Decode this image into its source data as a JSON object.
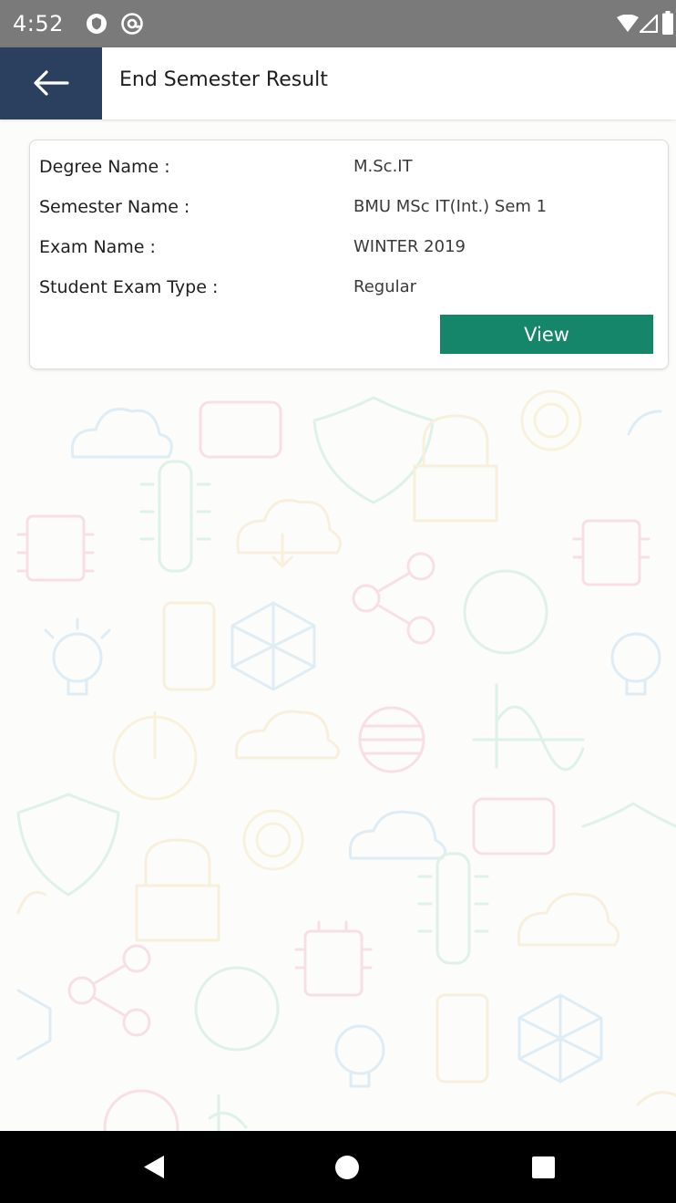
{
  "status_bar": {
    "time": "4:52",
    "left_icons": [
      "shield-icon",
      "at-sign-icon"
    ],
    "right_icons": [
      "wifi-icon",
      "signal-icon",
      "battery-icon"
    ],
    "background": "#7a7a7a"
  },
  "app_bar": {
    "title": "End Semester Result",
    "back_icon": "arrow-left-icon",
    "back_background": "#2b3f5f"
  },
  "result_card": {
    "rows": [
      {
        "label": "Degree Name :",
        "value": "M.Sc.IT"
      },
      {
        "label": "Semester Name :",
        "value": "BMU MSc IT(Int.) Sem 1"
      },
      {
        "label": "Exam Name :",
        "value": "WINTER 2019"
      },
      {
        "label": "Student Exam Type :",
        "value": "Regular"
      }
    ],
    "view_label": "View",
    "view_color": "#16866a"
  },
  "nav_bar": {
    "icons": [
      "back-triangle-icon",
      "home-circle-icon",
      "recents-square-icon"
    ]
  }
}
